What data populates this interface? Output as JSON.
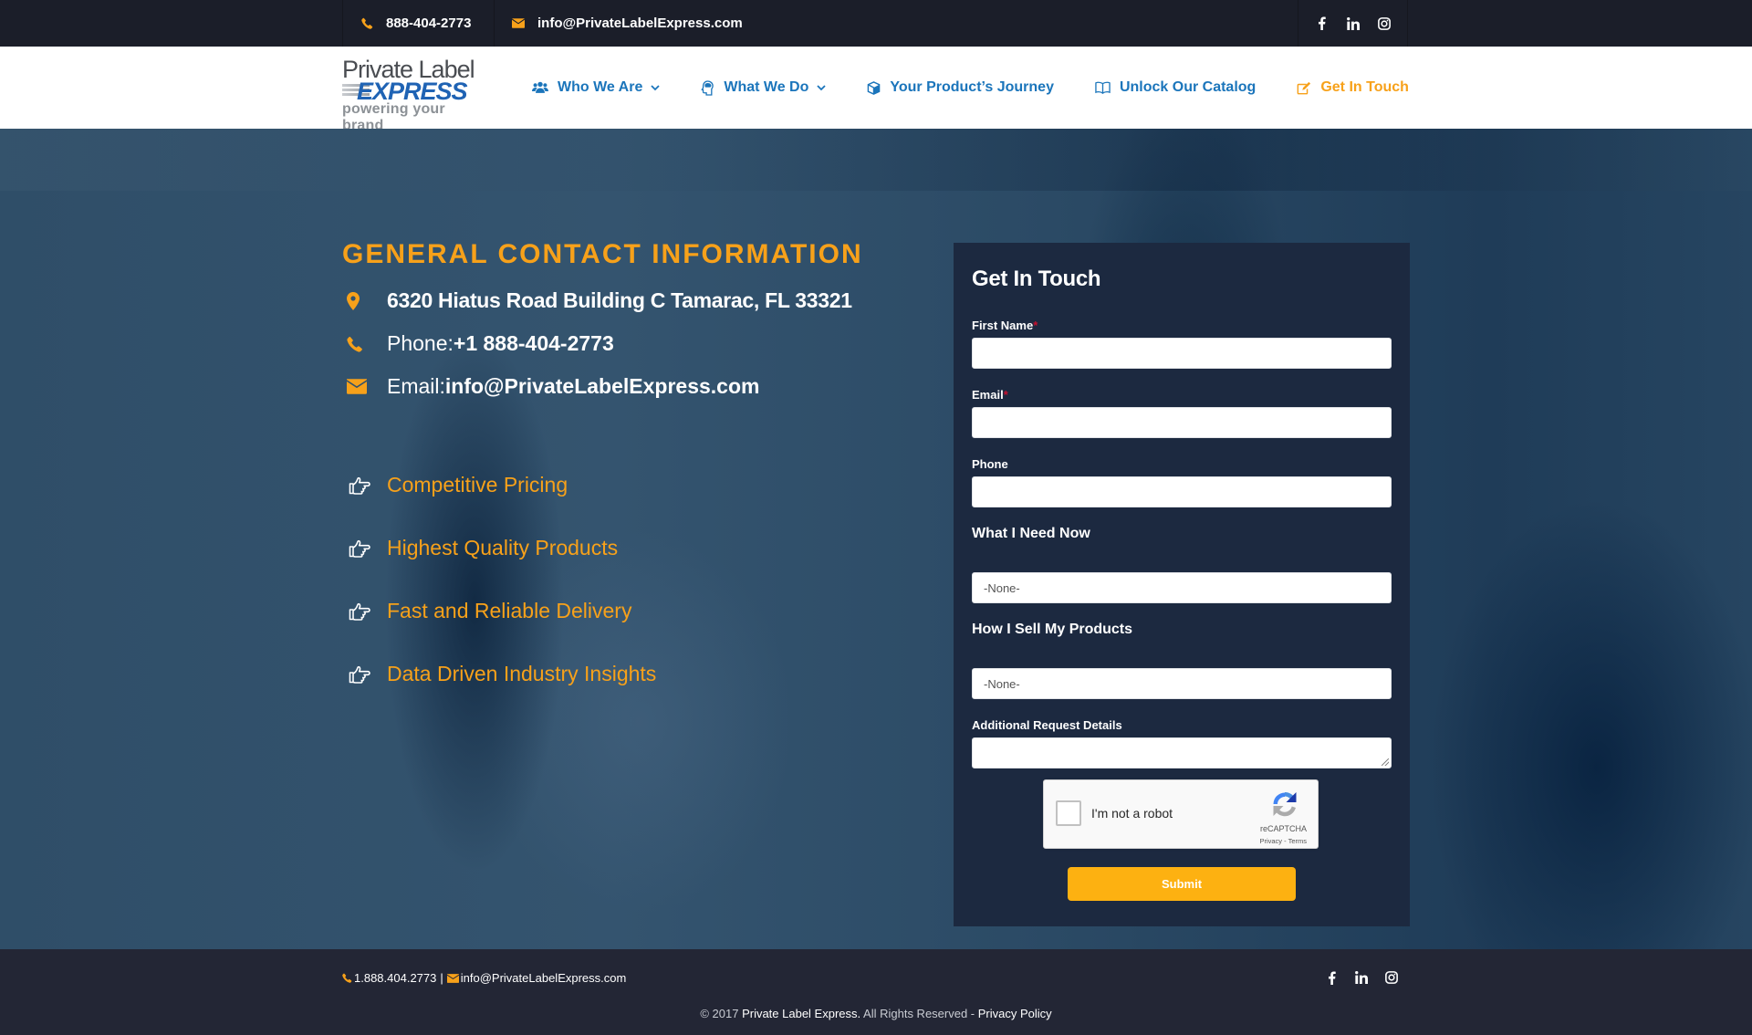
{
  "topbar": {
    "phone": "888-404-2773",
    "email": "info@PrivateLabelExpress.com",
    "social": [
      "facebook-icon",
      "linkedin-icon",
      "instagram-icon"
    ]
  },
  "logo": {
    "line1": "Private Label",
    "line2": "EXPRESS",
    "tagline": "powering your brand"
  },
  "nav": {
    "items": [
      {
        "label": "Who We Are",
        "icon": "users-icon",
        "dropdown": true
      },
      {
        "label": "What We Do",
        "icon": "head-icon",
        "dropdown": true
      },
      {
        "label": "Your Product’s Journey",
        "icon": "cube-icon",
        "dropdown": false
      },
      {
        "label": "Unlock Our Catalog",
        "icon": "book-icon",
        "dropdown": false
      },
      {
        "label": "Get In Touch",
        "icon": "edit-icon",
        "dropdown": false,
        "active": true
      }
    ]
  },
  "contact": {
    "heading": "GENERAL CONTACT INFORMATION",
    "address": "6320 Hiatus Road Building C Tamarac, FL 33321",
    "phone_label": "Phone: ",
    "phone": "+1 888-404-2773",
    "email_label": "Email: ",
    "email": "info@PrivateLabelExpress.com"
  },
  "features": [
    "Competitive Pricing",
    "Highest Quality Products",
    "Fast and Reliable Delivery",
    "Data Driven Industry Insights"
  ],
  "form": {
    "title": "Get In Touch",
    "first_name_label": "First Name",
    "first_name_value": "",
    "email_label": "Email",
    "email_value": "",
    "phone_label": "Phone",
    "phone_value": "",
    "required_mark": "*",
    "need_label": "What I Need Now",
    "need_value": "-None-",
    "sell_label": "How I Sell My Products",
    "sell_value": "-None-",
    "details_label": "Additional Request Details",
    "details_value": "",
    "captcha_text": "I'm not a robot",
    "captcha_brand": "reCAPTCHA",
    "captcha_terms": "Privacy - Terms",
    "submit_label": "Submit"
  },
  "footer": {
    "phone": "1.888.404.2773",
    "separator": "|",
    "email": "info@PrivateLabelExpress.com",
    "copyright_prefix": "© 2017 ",
    "company": "Private Label Express.",
    "rights": " All Rights Reserved - ",
    "privacy": "Privacy Policy"
  },
  "colors": {
    "accent_orange": "#f7a11a",
    "nav_blue": "#1b75bb",
    "panel_bg": "#1c2940",
    "topbar_bg": "#1b1e29",
    "footer_bg": "#232635",
    "submit_bg": "#fdb111"
  }
}
